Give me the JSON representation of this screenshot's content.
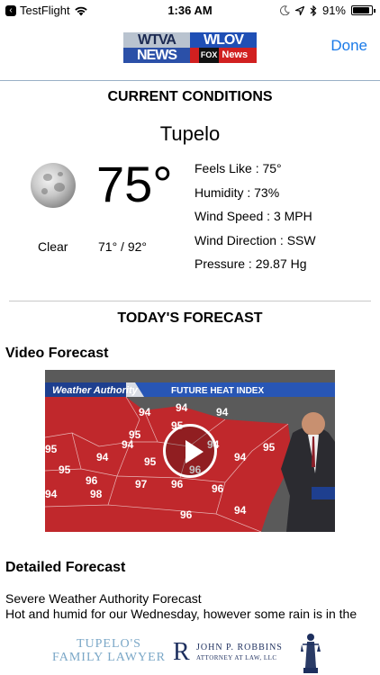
{
  "status_bar": {
    "back_app": "TestFlight",
    "time": "1:36 AM",
    "battery": "91%",
    "battery_level": 0.91
  },
  "nav": {
    "logo_wtva_top": "WTVA",
    "logo_wtva_bottom": "NEWS",
    "logo_wlov_top": "WLOV",
    "logo_wlov_fox": "FOX",
    "logo_wlov_bottom": "News",
    "done_label": "Done"
  },
  "current": {
    "heading": "CURRENT CONDITIONS",
    "city": "Tupelo",
    "temperature": "75°",
    "condition": "Clear",
    "hi_lo": "71° / 92°",
    "icon": "moon-icon",
    "stats": [
      {
        "label": "Feels Like :",
        "value": "75°"
      },
      {
        "label": "Humidity :",
        "value": "73%"
      },
      {
        "label": "Wind Speed :",
        "value": "3 MPH"
      },
      {
        "label": "Wind Direction :",
        "value": "SSW"
      },
      {
        "label": "Pressure :",
        "value": "29.87 Hg"
      }
    ]
  },
  "forecast": {
    "heading": "TODAY'S FORECAST",
    "video_title": "Video Forecast",
    "video_banner_brand": "Weather Authority",
    "video_banner_title": "FUTURE HEAT INDEX",
    "video_map_values": [
      "94",
      "94",
      "94",
      "95",
      "95",
      "94",
      "95",
      "94",
      "95",
      "94",
      "95",
      "96",
      "94",
      "95",
      "96",
      "97",
      "96",
      "96",
      "94",
      "98",
      "96",
      "94"
    ],
    "detailed_title": "Detailed Forecast",
    "detail_line1": "Severe Weather Authority Forecast",
    "detail_line2": "Hot and humid for our Wednesday, however some rain is in the"
  },
  "ad": {
    "left_line1": "TUPELO'S",
    "left_line2": "FAMILY LAWYER",
    "mark": "R",
    "name": "JOHN P. ROBBINS",
    "subtitle": "ATTORNEY AT LAW, LLC"
  },
  "colors": {
    "accent": "#1a7ae8",
    "map_red": "#c0282c"
  }
}
